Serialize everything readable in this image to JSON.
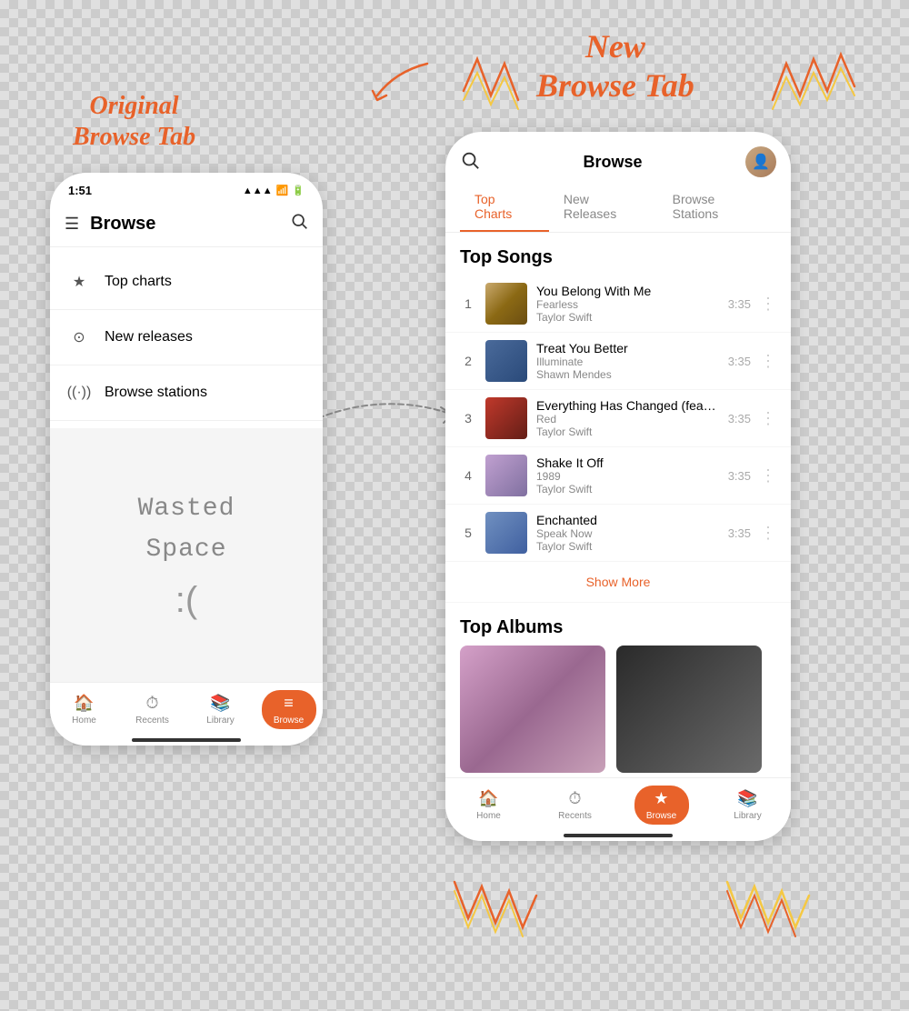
{
  "page": {
    "background": "checkered"
  },
  "labels": {
    "original": "Original\nBrowse Tab",
    "new": "New\nBrowse Tab"
  },
  "phone_left": {
    "status_bar": {
      "time": "1:51",
      "signal": "▲▲▲",
      "wifi": "WiFi",
      "battery": "Battery"
    },
    "header": {
      "title": "Browse",
      "menu_icon": "☰"
    },
    "menu_items": [
      {
        "icon": "★",
        "label": "Top charts"
      },
      {
        "icon": "⊘",
        "label": "New releases"
      },
      {
        "icon": "((·))",
        "label": "Browse stations"
      }
    ],
    "wasted_space": {
      "text": "Wasted\nSpace",
      "face": ":("
    },
    "nav": [
      {
        "icon": "⌂",
        "label": "Home",
        "active": false
      },
      {
        "icon": "↺",
        "label": "Recents",
        "active": false
      },
      {
        "icon": "▣",
        "label": "Library",
        "active": false
      },
      {
        "icon": "≡",
        "label": "Browse",
        "active": true
      }
    ]
  },
  "phone_right": {
    "header": {
      "title": "Browse"
    },
    "tabs": [
      {
        "label": "Top Charts",
        "active": true
      },
      {
        "label": "New Releases",
        "active": false
      },
      {
        "label": "Browse Stations",
        "active": false
      }
    ],
    "top_songs": {
      "section_title": "Top Songs",
      "songs": [
        {
          "rank": "1",
          "title": "You Belong With Me",
          "album": "Fearless",
          "artist": "Taylor Swift",
          "duration": "3:35"
        },
        {
          "rank": "2",
          "title": "Treat You Better",
          "album": "Illuminate",
          "artist": "Shawn Mendes",
          "duration": "3:35"
        },
        {
          "rank": "3",
          "title": "Everything Has Changed (feat. Ed...",
          "album": "Red",
          "artist": "Taylor Swift",
          "duration": "3:35"
        },
        {
          "rank": "4",
          "title": "Shake It Off",
          "album": "1989",
          "artist": "Taylor Swift",
          "duration": "3:35"
        },
        {
          "rank": "5",
          "title": "Enchanted",
          "album": "Speak Now",
          "artist": "Taylor Swift",
          "duration": "3:35"
        }
      ],
      "show_more": "Show More"
    },
    "top_albums": {
      "section_title": "Top Albums"
    },
    "nav": [
      {
        "icon": "⌂",
        "label": "Home",
        "active": false
      },
      {
        "icon": "↺",
        "label": "Recents",
        "active": false
      },
      {
        "icon": "★",
        "label": "Browse",
        "active": true
      },
      {
        "icon": "▣",
        "label": "Library",
        "active": false
      }
    ]
  },
  "colors": {
    "accent": "#e8622a",
    "text_primary": "#222",
    "text_secondary": "#888",
    "border": "#eee"
  }
}
